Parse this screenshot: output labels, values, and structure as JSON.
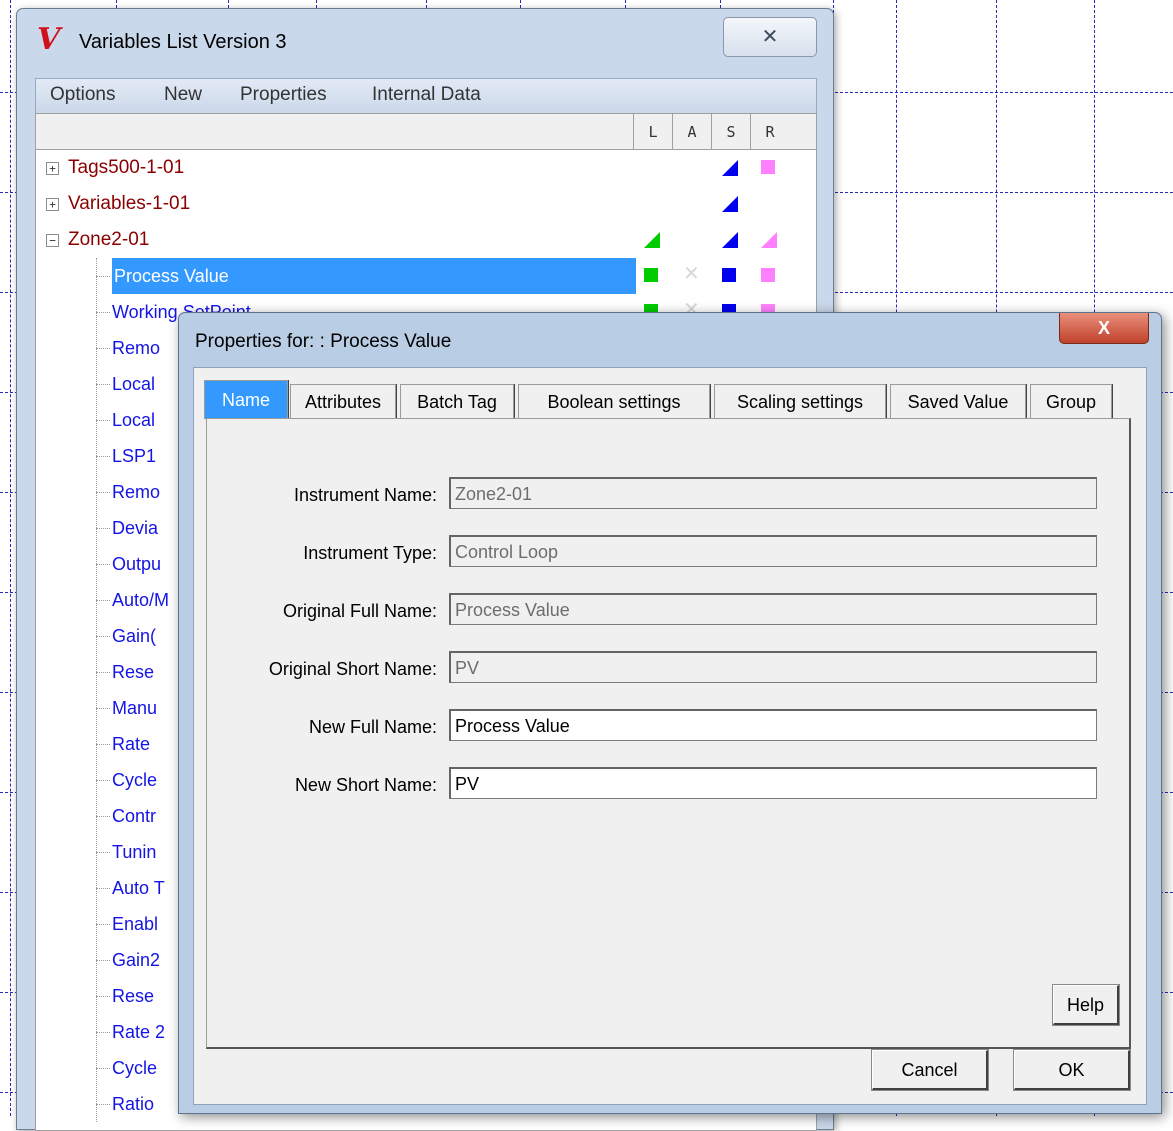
{
  "variables_window": {
    "title": "Variables List Version 3",
    "logo": "V",
    "close_glyph": "✕",
    "menu": [
      "Options",
      "New",
      "Properties",
      "Internal Data"
    ],
    "columns": [
      "L",
      "A",
      "S",
      "R"
    ],
    "groups": [
      {
        "label": "Tags500-1-01",
        "expander": "+"
      },
      {
        "label": "Variables-1-01",
        "expander": "+"
      },
      {
        "label": "Zone2-01",
        "expander": "−"
      }
    ],
    "items": [
      "Process Value",
      "Working SetPoint",
      "Remo",
      "Local",
      "Local",
      "LSP1",
      "Remo",
      "Devia",
      "Outpu",
      "Auto/M",
      "Gain(",
      "Rese",
      "Manu",
      "Rate",
      "Cycle",
      "Contr",
      "Tunin",
      "Auto T",
      "Enabl",
      "Gain2",
      "Rese",
      "Rate 2",
      "Cycle",
      "Ratio"
    ],
    "selected_item": "Process Value",
    "colors": {
      "green": "#00cc00",
      "blue": "#0000ee",
      "pink": "#ff80ff",
      "red_text": "#8b0000"
    }
  },
  "dialog": {
    "title": "Properties for: : Process Value",
    "close_glyph": "X",
    "tabs": [
      "Name",
      "Attributes",
      "Batch Tag",
      "Boolean settings",
      "Scaling settings",
      "Saved Value",
      "Group"
    ],
    "active_tab": "Name",
    "fields": [
      {
        "label": "Instrument Name:",
        "value": "Zone2-01",
        "readonly": true
      },
      {
        "label": "Instrument Type:",
        "value": "Control Loop",
        "readonly": true
      },
      {
        "label": "Original Full Name:",
        "value": "Process Value",
        "readonly": true
      },
      {
        "label": "Original Short Name:",
        "value": "PV",
        "readonly": true
      },
      {
        "label": "New Full Name:",
        "value": "Process Value",
        "readonly": false
      },
      {
        "label": "New Short Name:",
        "value": "PV",
        "readonly": false
      }
    ],
    "help_label": "Help",
    "cancel_label": "Cancel",
    "ok_label": "OK"
  }
}
